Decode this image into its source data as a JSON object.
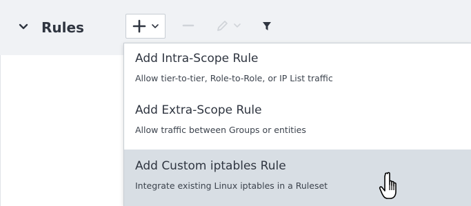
{
  "header": {
    "title": "Rules",
    "collapse_icon": "chevron-down-icon"
  },
  "toolbar": {
    "add_icon": "plus-icon",
    "add_caret_icon": "chevron-down-icon",
    "remove_icon": "minus-icon",
    "edit_icon": "pencil-icon",
    "edit_caret_icon": "chevron-down-icon",
    "filter_icon": "funnel-icon"
  },
  "add_menu": {
    "items": [
      {
        "label": "Add Intra-Scope Rule",
        "description": "Allow tier-to-tier, Role-to-Role, or IP List traffic"
      },
      {
        "label": "Add Extra-Scope Rule",
        "description": "Allow traffic between Groups or entities"
      },
      {
        "label": "Add Custom iptables Rule",
        "description": "Integrate existing Linux iptables in a Ruleset",
        "highlighted": true
      }
    ]
  },
  "cursor": {
    "icon": "hand-pointer-icon"
  },
  "colors": {
    "header_bg": "#f0f2f5",
    "text_primary": "#2f3540",
    "highlight_bg": "#d8dee4",
    "border": "#c7cdd3",
    "disabled_icon": "#d0d4d9"
  }
}
